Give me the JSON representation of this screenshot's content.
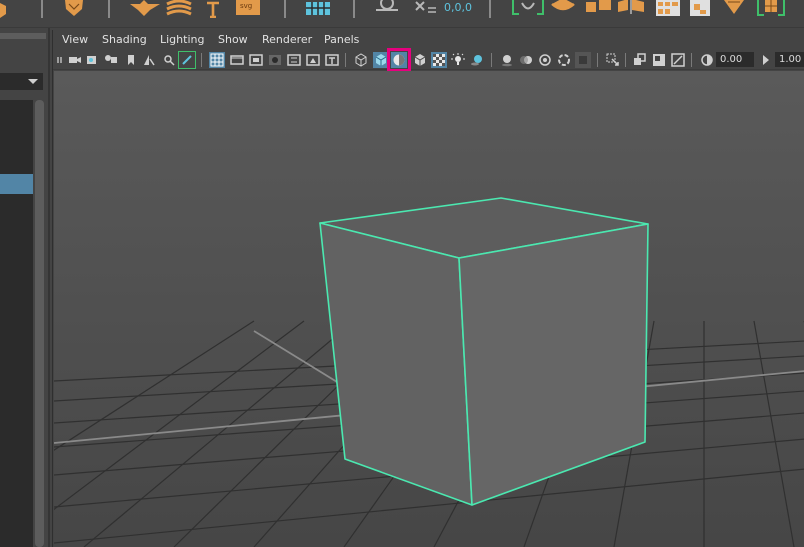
{
  "shelf": {
    "readout": "0,0,0",
    "icons": [
      "polygon-sphere-icon",
      "polygon-cone-icon",
      "polygon-helix-icon",
      "type-icon",
      "svg-icon",
      "snap-grid-icon",
      "live-surface-icon",
      "transform-icon",
      "select-curve-icon",
      "shape-icon",
      "combine-icon",
      "separate-icon",
      "extract-icon",
      "bevel-icon",
      "bridge-icon"
    ]
  },
  "viewport_menu": {
    "items": [
      "View",
      "Shading",
      "Lighting",
      "Show",
      "Renderer",
      "Panels"
    ]
  },
  "viewport_toolbar": {
    "exposure_value": "0.00",
    "gamma_value": "1.00",
    "highlighted_button": "smooth-shade-all-icon"
  },
  "colors": {
    "accent_blue": "#5285a6",
    "highlight_magenta": "#e6007e",
    "selection_green": "#4be8b0",
    "shelf_orange": "#e29a4a",
    "readout_cyan": "#5ec3dd"
  }
}
